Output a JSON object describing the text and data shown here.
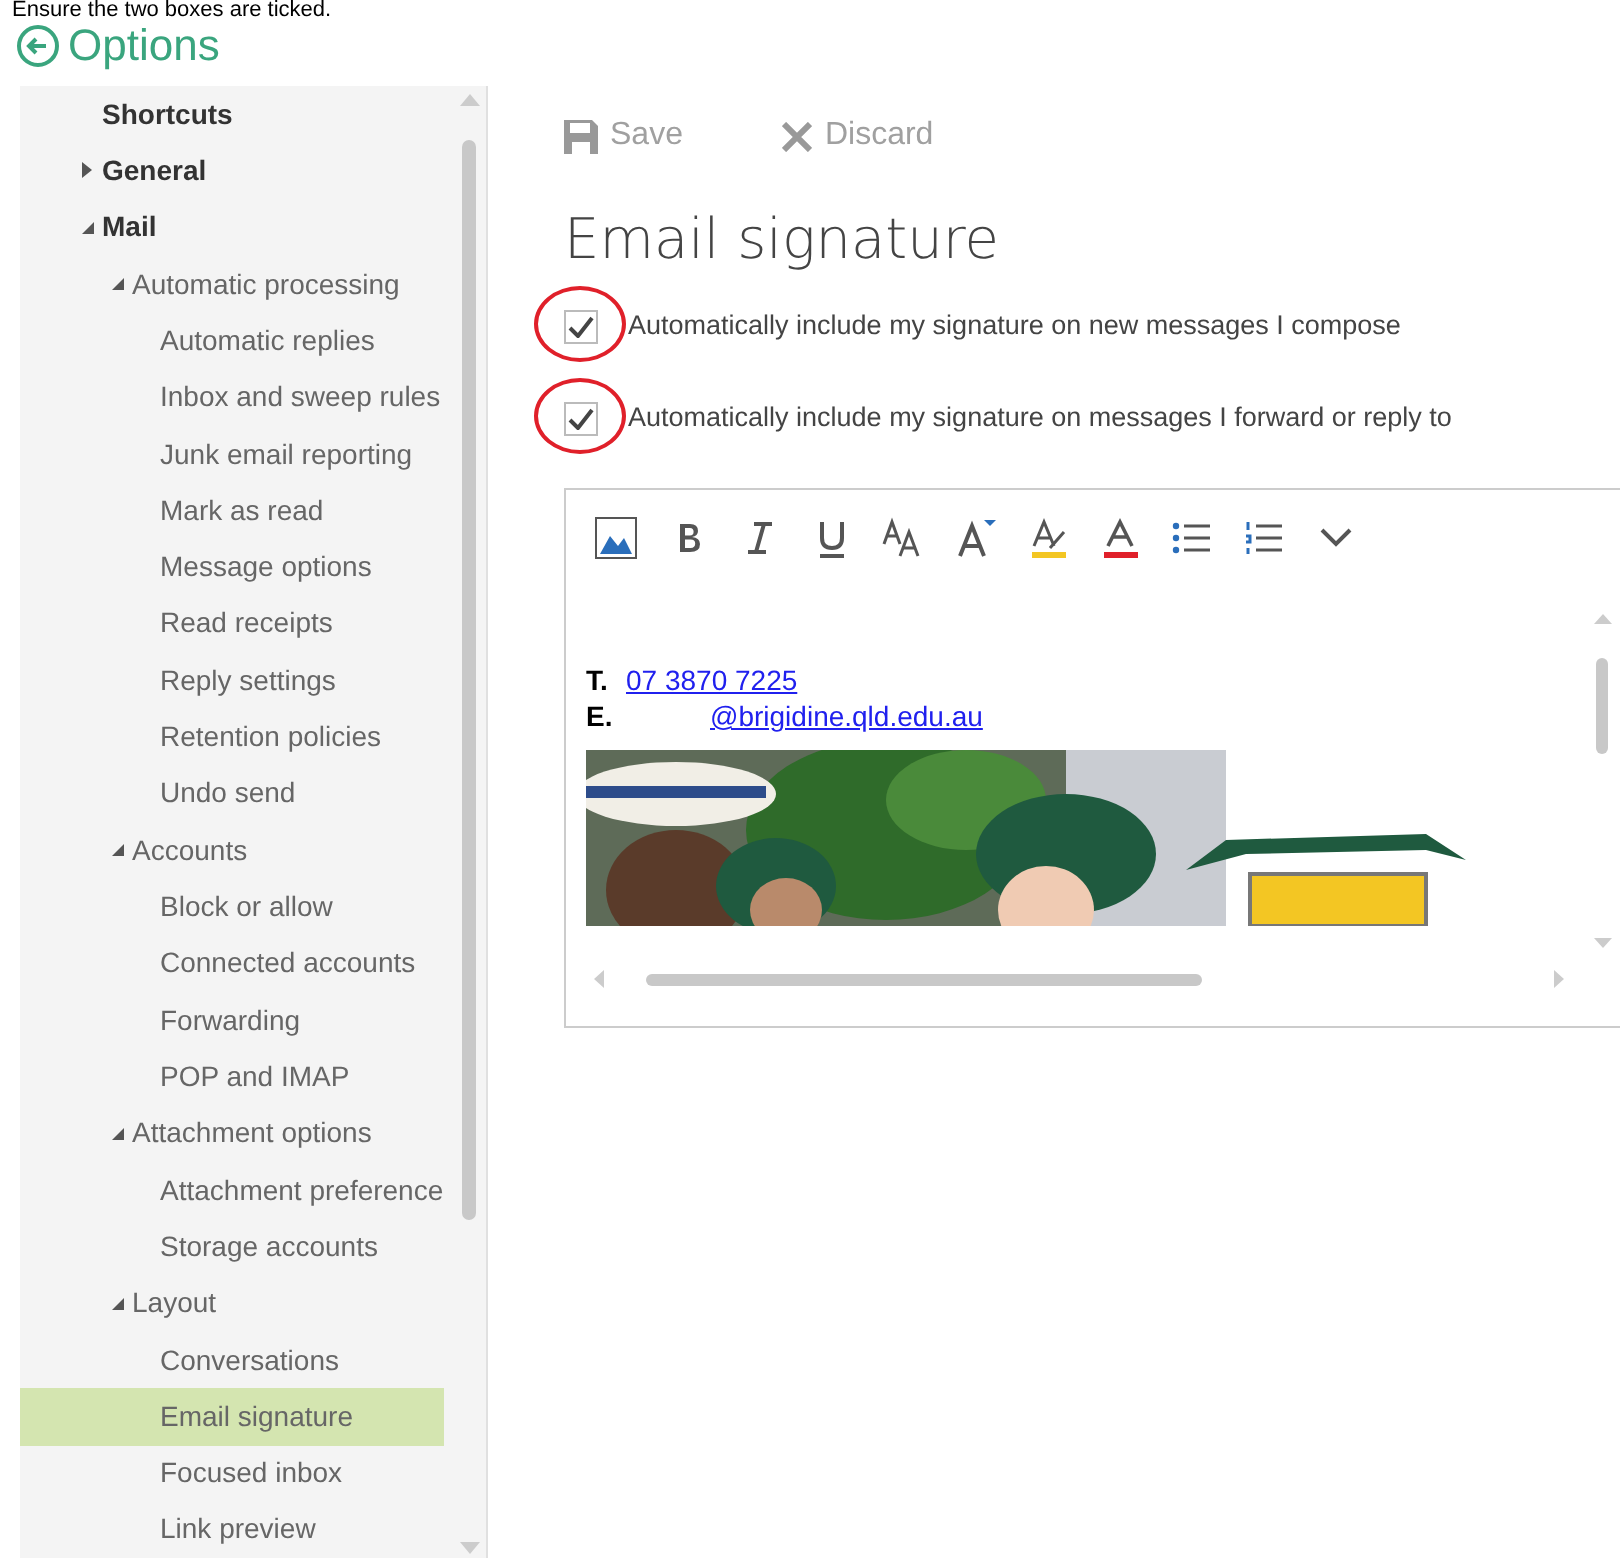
{
  "instruction": "Ensure the two boxes are ticked.",
  "header": {
    "title": "Options"
  },
  "sidebar": {
    "items": [
      {
        "label": "Shortcuts",
        "selected": false
      },
      {
        "label": "General",
        "expanded": false,
        "selected": false
      },
      {
        "label": "Mail",
        "expanded": true,
        "selected": false,
        "children": [
          {
            "label": "Automatic processing",
            "expanded": true,
            "selected": false,
            "children": [
              {
                "label": "Automatic replies",
                "selected": false
              },
              {
                "label": "Inbox and sweep rules",
                "selected": false
              },
              {
                "label": "Junk email reporting",
                "selected": false
              },
              {
                "label": "Mark as read",
                "selected": false
              },
              {
                "label": "Message options",
                "selected": false
              },
              {
                "label": "Read receipts",
                "selected": false
              },
              {
                "label": "Reply settings",
                "selected": false
              },
              {
                "label": "Retention policies",
                "selected": false
              },
              {
                "label": "Undo send",
                "selected": false
              }
            ]
          },
          {
            "label": "Accounts",
            "expanded": true,
            "selected": false,
            "children": [
              {
                "label": "Block or allow",
                "selected": false
              },
              {
                "label": "Connected accounts",
                "selected": false
              },
              {
                "label": "Forwarding",
                "selected": false
              },
              {
                "label": "POP and IMAP",
                "selected": false
              }
            ]
          },
          {
            "label": "Attachment options",
            "expanded": true,
            "selected": false,
            "children": [
              {
                "label": "Attachment preference",
                "selected": false
              },
              {
                "label": "Storage accounts",
                "selected": false
              }
            ]
          },
          {
            "label": "Layout",
            "expanded": true,
            "selected": false,
            "children": [
              {
                "label": "Conversations",
                "selected": false
              },
              {
                "label": "Email signature",
                "selected": true
              },
              {
                "label": "Focused inbox",
                "selected": false
              },
              {
                "label": "Link preview",
                "selected": false
              }
            ]
          }
        ]
      }
    ]
  },
  "toolbar": [
    {
      "kind": "save",
      "label": "Save",
      "disabled": true
    },
    {
      "kind": "discard",
      "label": "Discard",
      "disabled": true
    }
  ],
  "title": "Email signature",
  "options": [
    {
      "label": "Automatically include my signature on new messages I compose",
      "checked": true,
      "circled": true
    },
    {
      "label": "Automatically include my signature on messages I forward or reply to",
      "checked": true,
      "circled": true
    }
  ],
  "signature": {
    "lines": [
      {
        "label": "T.",
        "link": "07 3870 7225"
      },
      {
        "label": "E.",
        "link": "@brigidine.qld.edu.au"
      }
    ]
  }
}
